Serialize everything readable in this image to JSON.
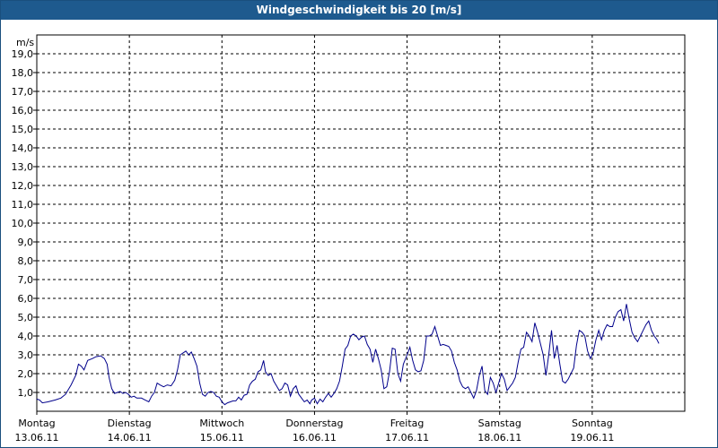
{
  "window": {
    "title": "Windgeschwindigkeit bis 20 [m/s]"
  },
  "colors": {
    "title_bar": "#1e5a8e",
    "series": "#00008b",
    "grid": "#000000"
  },
  "chart_data": {
    "type": "line",
    "title": "Windgeschwindigkeit bis 20 [m/s]",
    "ylabel": "m/s",
    "ylim": [
      0,
      20
    ],
    "yticks": [
      {
        "v": 1,
        "label": "1,0"
      },
      {
        "v": 2,
        "label": "2,0"
      },
      {
        "v": 3,
        "label": "3,0"
      },
      {
        "v": 4,
        "label": "4,0"
      },
      {
        "v": 5,
        "label": "5,0"
      },
      {
        "v": 6,
        "label": "6,0"
      },
      {
        "v": 7,
        "label": "7,0"
      },
      {
        "v": 8,
        "label": "8,0"
      },
      {
        "v": 9,
        "label": "9,0"
      },
      {
        "v": 10,
        "label": "10,0"
      },
      {
        "v": 11,
        "label": "11,0"
      },
      {
        "v": 12,
        "label": "12,0"
      },
      {
        "v": 13,
        "label": "13,0"
      },
      {
        "v": 14,
        "label": "14,0"
      },
      {
        "v": 15,
        "label": "15,0"
      },
      {
        "v": 16,
        "label": "16,0"
      },
      {
        "v": 17,
        "label": "17,0"
      },
      {
        "v": 18,
        "label": "18,0"
      },
      {
        "v": 19,
        "label": "19,0"
      }
    ],
    "xlim": [
      0,
      7
    ],
    "days": [
      {
        "name": "Montag",
        "date": "13.06.11"
      },
      {
        "name": "Dienstag",
        "date": "14.06.11"
      },
      {
        "name": "Mittwoch",
        "date": "15.06.11"
      },
      {
        "name": "Donnerstag",
        "date": "16.06.11"
      },
      {
        "name": "Freitag",
        "date": "17.06.11"
      },
      {
        "name": "Samstag",
        "date": "18.06.11"
      },
      {
        "name": "Sonntag",
        "date": "19.06.11"
      }
    ],
    "grid": true,
    "series": [
      {
        "points": [
          [
            0.0,
            0.65
          ],
          [
            0.03,
            0.6
          ],
          [
            0.06,
            0.45
          ],
          [
            0.12,
            0.5
          ],
          [
            0.2,
            0.6
          ],
          [
            0.26,
            0.7
          ],
          [
            0.31,
            0.9
          ],
          [
            0.37,
            1.4
          ],
          [
            0.42,
            1.9
          ],
          [
            0.45,
            2.5
          ],
          [
            0.48,
            2.4
          ],
          [
            0.51,
            2.2
          ],
          [
            0.55,
            2.7
          ],
          [
            0.6,
            2.8
          ],
          [
            0.64,
            2.9
          ],
          [
            0.69,
            2.95
          ],
          [
            0.73,
            2.8
          ],
          [
            0.76,
            2.5
          ],
          [
            0.78,
            1.8
          ],
          [
            0.81,
            1.2
          ],
          [
            0.84,
            0.95
          ],
          [
            0.87,
            1.0
          ],
          [
            0.9,
            1.05
          ],
          [
            0.93,
            0.95
          ],
          [
            0.96,
            1.0
          ],
          [
            0.99,
            0.9
          ],
          [
            1.02,
            0.75
          ],
          [
            1.05,
            0.8
          ],
          [
            1.08,
            0.7
          ],
          [
            1.13,
            0.7
          ],
          [
            1.17,
            0.6
          ],
          [
            1.21,
            0.5
          ],
          [
            1.24,
            0.8
          ],
          [
            1.27,
            1.0
          ],
          [
            1.3,
            1.5
          ],
          [
            1.33,
            1.4
          ],
          [
            1.37,
            1.3
          ],
          [
            1.41,
            1.4
          ],
          [
            1.45,
            1.35
          ],
          [
            1.49,
            1.65
          ],
          [
            1.52,
            2.2
          ],
          [
            1.55,
            3.0
          ],
          [
            1.58,
            3.1
          ],
          [
            1.61,
            3.2
          ],
          [
            1.64,
            3.0
          ],
          [
            1.67,
            3.15
          ],
          [
            1.7,
            2.8
          ],
          [
            1.73,
            2.4
          ],
          [
            1.76,
            1.5
          ],
          [
            1.79,
            0.9
          ],
          [
            1.82,
            0.8
          ],
          [
            1.85,
            1.0
          ],
          [
            1.88,
            1.05
          ],
          [
            1.91,
            1.0
          ],
          [
            1.94,
            0.8
          ],
          [
            1.97,
            0.75
          ],
          [
            2.0,
            0.5
          ],
          [
            2.03,
            0.35
          ],
          [
            2.06,
            0.45
          ],
          [
            2.09,
            0.5
          ],
          [
            2.12,
            0.55
          ],
          [
            2.15,
            0.55
          ],
          [
            2.18,
            0.75
          ],
          [
            2.21,
            0.6
          ],
          [
            2.24,
            0.85
          ],
          [
            2.27,
            0.9
          ],
          [
            2.3,
            1.4
          ],
          [
            2.33,
            1.6
          ],
          [
            2.36,
            1.7
          ],
          [
            2.39,
            2.1
          ],
          [
            2.42,
            2.2
          ],
          [
            2.45,
            2.7
          ],
          [
            2.47,
            2.1
          ],
          [
            2.5,
            1.9
          ],
          [
            2.53,
            2.0
          ],
          [
            2.56,
            1.6
          ],
          [
            2.59,
            1.35
          ],
          [
            2.62,
            1.1
          ],
          [
            2.65,
            1.2
          ],
          [
            2.68,
            1.5
          ],
          [
            2.71,
            1.4
          ],
          [
            2.74,
            0.8
          ],
          [
            2.77,
            1.2
          ],
          [
            2.8,
            1.35
          ],
          [
            2.83,
            0.9
          ],
          [
            2.86,
            0.7
          ],
          [
            2.89,
            0.5
          ],
          [
            2.92,
            0.6
          ],
          [
            2.95,
            0.4
          ],
          [
            2.97,
            0.6
          ],
          [
            3.0,
            0.7
          ],
          [
            3.03,
            0.4
          ],
          [
            3.06,
            0.65
          ],
          [
            3.09,
            0.5
          ],
          [
            3.12,
            0.75
          ],
          [
            3.15,
            0.95
          ],
          [
            3.18,
            0.75
          ],
          [
            3.21,
            0.95
          ],
          [
            3.24,
            1.2
          ],
          [
            3.27,
            1.6
          ],
          [
            3.3,
            2.4
          ],
          [
            3.33,
            3.3
          ],
          [
            3.36,
            3.5
          ],
          [
            3.39,
            4.0
          ],
          [
            3.42,
            4.1
          ],
          [
            3.45,
            4.0
          ],
          [
            3.48,
            3.8
          ],
          [
            3.51,
            3.95
          ],
          [
            3.54,
            4.0
          ],
          [
            3.57,
            3.55
          ],
          [
            3.6,
            3.3
          ],
          [
            3.63,
            2.6
          ],
          [
            3.66,
            3.3
          ],
          [
            3.69,
            2.8
          ],
          [
            3.72,
            2.2
          ],
          [
            3.75,
            1.2
          ],
          [
            3.78,
            1.3
          ],
          [
            3.81,
            2.1
          ],
          [
            3.84,
            3.35
          ],
          [
            3.87,
            3.3
          ],
          [
            3.9,
            2.0
          ],
          [
            3.93,
            1.6
          ],
          [
            3.96,
            2.5
          ],
          [
            4.0,
            3.0
          ],
          [
            4.03,
            3.4
          ],
          [
            4.06,
            2.7
          ],
          [
            4.09,
            2.2
          ],
          [
            4.12,
            2.1
          ],
          [
            4.15,
            2.15
          ],
          [
            4.18,
            2.7
          ],
          [
            4.21,
            4.0
          ],
          [
            4.24,
            4.0
          ],
          [
            4.27,
            4.1
          ],
          [
            4.3,
            4.5
          ],
          [
            4.33,
            4.0
          ],
          [
            4.36,
            3.5
          ],
          [
            4.39,
            3.55
          ],
          [
            4.42,
            3.5
          ],
          [
            4.45,
            3.45
          ],
          [
            4.48,
            3.2
          ],
          [
            4.51,
            2.6
          ],
          [
            4.54,
            2.2
          ],
          [
            4.57,
            1.6
          ],
          [
            4.6,
            1.3
          ],
          [
            4.63,
            1.2
          ],
          [
            4.66,
            1.3
          ],
          [
            4.69,
            1.0
          ],
          [
            4.72,
            0.7
          ],
          [
            4.75,
            1.1
          ],
          [
            4.78,
            1.9
          ],
          [
            4.81,
            2.4
          ],
          [
            4.84,
            1.1
          ],
          [
            4.87,
            0.9
          ],
          [
            4.9,
            1.8
          ],
          [
            4.93,
            1.5
          ],
          [
            4.96,
            1.0
          ],
          [
            4.99,
            1.5
          ],
          [
            5.02,
            2.0
          ],
          [
            5.05,
            1.7
          ],
          [
            5.08,
            1.1
          ],
          [
            5.11,
            1.3
          ],
          [
            5.14,
            1.5
          ],
          [
            5.17,
            1.8
          ],
          [
            5.2,
            2.6
          ],
          [
            5.23,
            3.3
          ],
          [
            5.26,
            3.4
          ],
          [
            5.29,
            4.2
          ],
          [
            5.32,
            4.0
          ],
          [
            5.35,
            3.7
          ],
          [
            5.38,
            4.7
          ],
          [
            5.41,
            4.2
          ],
          [
            5.44,
            3.6
          ],
          [
            5.47,
            3.0
          ],
          [
            5.5,
            1.9
          ],
          [
            5.53,
            3.0
          ],
          [
            5.56,
            4.3
          ],
          [
            5.59,
            2.8
          ],
          [
            5.62,
            3.5
          ],
          [
            5.65,
            2.5
          ],
          [
            5.68,
            1.6
          ],
          [
            5.71,
            1.5
          ],
          [
            5.74,
            1.7
          ],
          [
            5.77,
            2.0
          ],
          [
            5.8,
            2.3
          ],
          [
            5.83,
            3.5
          ],
          [
            5.86,
            4.3
          ],
          [
            5.89,
            4.2
          ],
          [
            5.92,
            4.0
          ],
          [
            5.95,
            3.2
          ],
          [
            5.98,
            2.8
          ],
          [
            6.01,
            3.1
          ],
          [
            6.04,
            3.8
          ],
          [
            6.07,
            4.3
          ],
          [
            6.1,
            3.8
          ],
          [
            6.13,
            4.3
          ],
          [
            6.16,
            4.6
          ],
          [
            6.19,
            4.5
          ],
          [
            6.22,
            4.5
          ],
          [
            6.25,
            5.0
          ],
          [
            6.28,
            5.3
          ],
          [
            6.31,
            5.4
          ],
          [
            6.34,
            4.8
          ],
          [
            6.37,
            5.7
          ],
          [
            6.4,
            4.9
          ],
          [
            6.43,
            4.2
          ],
          [
            6.46,
            3.9
          ],
          [
            6.49,
            3.7
          ],
          [
            6.52,
            4.0
          ],
          [
            6.55,
            4.3
          ],
          [
            6.58,
            4.6
          ],
          [
            6.61,
            4.8
          ],
          [
            6.64,
            4.3
          ],
          [
            6.67,
            4.0
          ],
          [
            6.7,
            3.8
          ],
          [
            6.72,
            3.6
          ]
        ]
      }
    ]
  }
}
